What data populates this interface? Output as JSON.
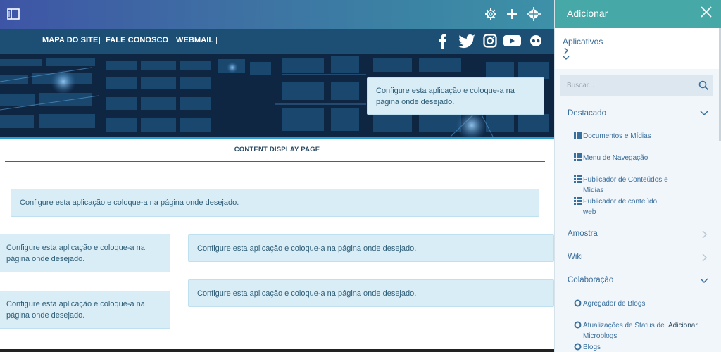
{
  "topbar": {
    "icons": [
      "sidebar-toggle-icon",
      "gear-icon",
      "plus-icon",
      "compass-icon"
    ]
  },
  "site_nav": {
    "links": [
      "MAPA DO SITE",
      "FALE CONOSCO",
      "WEBMAIL"
    ],
    "separator": "|",
    "social_icons": [
      "facebook-icon",
      "twitter-icon",
      "instagram-icon",
      "youtube-icon",
      "flickr-icon"
    ]
  },
  "content": {
    "config_message": "Configure esta aplicação e coloque-a na página onde desejado.",
    "banner_box_line1": "Configure esta aplicação e coloque-a na",
    "banner_box_line2": "página onde desejado.",
    "page_title": "CONTENT DISPLAY PAGE",
    "left_box_line1": "Configure esta aplicação e coloque-a na",
    "left_box_line2": "página onde desejado."
  },
  "panel": {
    "title": "Adicionar",
    "applications_label": "Aplicativos",
    "search": {
      "placeholder": "Buscar..."
    },
    "categories": {
      "featured": {
        "label": "Destacado",
        "items": [
          "Documentos e Mídias",
          "Menu de Navegação",
          "Publicador de Conteúdos e Mídias",
          "Publicador de conteúdo web"
        ]
      },
      "sample": {
        "label": "Amostra"
      },
      "wiki": {
        "label": "Wiki"
      },
      "collaboration": {
        "label": "Colaboração",
        "items": [
          "Agregador de Blogs",
          "Atualizações de Status de Microblogs",
          "Blogs"
        ],
        "add_label": "Adicionar"
      }
    }
  },
  "colors": {
    "panel_header": "#47a8a8",
    "nav_bar": "#1d4f75",
    "config_box": "#d9edf6",
    "accent_text": "#3a6e9c"
  }
}
